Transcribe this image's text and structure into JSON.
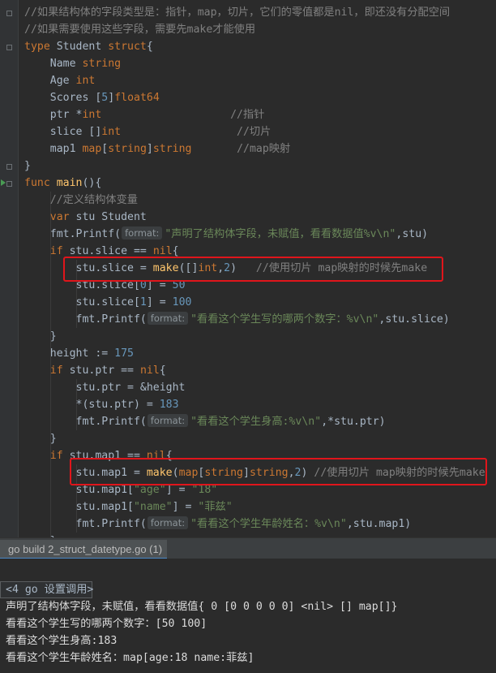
{
  "editor": {
    "lines": [
      [
        {
          "c": "c",
          "t": "//如果结构体的字段类型是：指针，map，切片，它们的零值都是nil，即还没有分配空间"
        }
      ],
      [
        {
          "c": "c",
          "t": "//如果需要使用这些字段，需要先make才能使用"
        }
      ],
      [
        {
          "c": "k",
          "t": "type "
        },
        {
          "c": "pl",
          "t": "Student "
        },
        {
          "c": "k",
          "t": "struct"
        },
        {
          "c": "pl",
          "t": "{"
        }
      ],
      [
        {
          "c": "pl",
          "t": "    Name "
        },
        {
          "c": "k",
          "t": "string"
        }
      ],
      [
        {
          "c": "pl",
          "t": "    Age "
        },
        {
          "c": "k",
          "t": "int"
        }
      ],
      [
        {
          "c": "pl",
          "t": "    Scores ["
        },
        {
          "c": "n",
          "t": "5"
        },
        {
          "c": "pl",
          "t": "]"
        },
        {
          "c": "k",
          "t": "float64"
        }
      ],
      [
        {
          "c": "pl",
          "t": "    ptr *"
        },
        {
          "c": "k",
          "t": "int"
        },
        {
          "c": "pl",
          "t": "                    "
        },
        {
          "c": "c",
          "t": "//指针"
        }
      ],
      [
        {
          "c": "pl",
          "t": "    slice []"
        },
        {
          "c": "k",
          "t": "int"
        },
        {
          "c": "pl",
          "t": "                  "
        },
        {
          "c": "c",
          "t": "//切片"
        }
      ],
      [
        {
          "c": "pl",
          "t": "    map1 "
        },
        {
          "c": "k",
          "t": "map"
        },
        {
          "c": "pl",
          "t": "["
        },
        {
          "c": "k",
          "t": "string"
        },
        {
          "c": "pl",
          "t": "]"
        },
        {
          "c": "k",
          "t": "string"
        },
        {
          "c": "pl",
          "t": "       "
        },
        {
          "c": "c",
          "t": "//map映射"
        }
      ],
      [
        {
          "c": "pl",
          "t": "}"
        }
      ],
      [
        {
          "c": "k",
          "t": "func "
        },
        {
          "c": "f",
          "t": "main"
        },
        {
          "c": "pl",
          "t": "(){"
        }
      ],
      [
        {
          "c": "pl",
          "t": "    "
        },
        {
          "c": "c",
          "t": "//定义结构体变量"
        }
      ],
      [
        {
          "c": "pl",
          "t": "    "
        },
        {
          "c": "k",
          "t": "var "
        },
        {
          "c": "pl",
          "t": "stu Student"
        }
      ],
      [
        {
          "c": "pl",
          "t": "    fmt."
        },
        {
          "c": "pl",
          "t": "Printf("
        },
        {
          "c": "hint",
          "t": "format:"
        },
        {
          "c": "s",
          "t": "\"声明了结构体字段，未赋值，看看数据值%v\\n\""
        },
        {
          "c": "pl",
          "t": ",stu)"
        }
      ],
      [
        {
          "c": "pl",
          "t": "    "
        },
        {
          "c": "k",
          "t": "if "
        },
        {
          "c": "pl",
          "t": "stu.slice == "
        },
        {
          "c": "k",
          "t": "nil"
        },
        {
          "c": "pl",
          "t": "{"
        }
      ],
      [
        {
          "c": "pl",
          "t": "        stu.slice = "
        },
        {
          "c": "f",
          "t": "make"
        },
        {
          "c": "pl",
          "t": "([]"
        },
        {
          "c": "k",
          "t": "int"
        },
        {
          "c": "pl",
          "t": ","
        },
        {
          "c": "n",
          "t": "2"
        },
        {
          "c": "pl",
          "t": ")   "
        },
        {
          "c": "c",
          "t": "//使用切片 map映射的时候先make"
        }
      ],
      [
        {
          "c": "pl",
          "t": "        stu.slice["
        },
        {
          "c": "n",
          "t": "0"
        },
        {
          "c": "pl",
          "t": "] = "
        },
        {
          "c": "n",
          "t": "50"
        }
      ],
      [
        {
          "c": "pl",
          "t": "        stu.slice["
        },
        {
          "c": "n",
          "t": "1"
        },
        {
          "c": "pl",
          "t": "] = "
        },
        {
          "c": "n",
          "t": "100"
        }
      ],
      [
        {
          "c": "pl",
          "t": "        fmt.Printf("
        },
        {
          "c": "hint",
          "t": "format:"
        },
        {
          "c": "s",
          "t": "\"看看这个学生写的哪两个数字：%v\\n\""
        },
        {
          "c": "pl",
          "t": ",stu.slice)"
        }
      ],
      [
        {
          "c": "pl",
          "t": "    }"
        }
      ],
      [
        {
          "c": "pl",
          "t": "    height := "
        },
        {
          "c": "n",
          "t": "175"
        }
      ],
      [
        {
          "c": "pl",
          "t": "    "
        },
        {
          "c": "k",
          "t": "if "
        },
        {
          "c": "pl",
          "t": "stu.ptr == "
        },
        {
          "c": "k",
          "t": "nil"
        },
        {
          "c": "pl",
          "t": "{"
        }
      ],
      [
        {
          "c": "pl",
          "t": "        stu.ptr = &height"
        }
      ],
      [
        {
          "c": "pl",
          "t": "        *(stu.ptr) = "
        },
        {
          "c": "n",
          "t": "183"
        }
      ],
      [
        {
          "c": "pl",
          "t": "        fmt.Printf("
        },
        {
          "c": "hint",
          "t": "format:"
        },
        {
          "c": "s",
          "t": "\"看看这个学生身高:%v\\n\""
        },
        {
          "c": "pl",
          "t": ",*stu.ptr)"
        }
      ],
      [
        {
          "c": "pl",
          "t": "    }"
        }
      ],
      [
        {
          "c": "pl",
          "t": "    "
        },
        {
          "c": "k",
          "t": "if "
        },
        {
          "c": "pl",
          "t": "stu.map1 == "
        },
        {
          "c": "k",
          "t": "nil"
        },
        {
          "c": "pl",
          "t": "{"
        }
      ],
      [
        {
          "c": "pl",
          "t": "        stu.map1 = "
        },
        {
          "c": "f",
          "t": "make"
        },
        {
          "c": "pl",
          "t": "("
        },
        {
          "c": "k",
          "t": "map"
        },
        {
          "c": "pl",
          "t": "["
        },
        {
          "c": "k",
          "t": "string"
        },
        {
          "c": "pl",
          "t": "]"
        },
        {
          "c": "k",
          "t": "string"
        },
        {
          "c": "pl",
          "t": ","
        },
        {
          "c": "n",
          "t": "2"
        },
        {
          "c": "pl",
          "t": ") "
        },
        {
          "c": "c",
          "t": "//使用切片 map映射的时候先make"
        }
      ],
      [
        {
          "c": "pl",
          "t": "        stu.map1["
        },
        {
          "c": "s",
          "t": "\"age\""
        },
        {
          "c": "pl",
          "t": "] = "
        },
        {
          "c": "s",
          "t": "\"18\""
        }
      ],
      [
        {
          "c": "pl",
          "t": "        stu.map1["
        },
        {
          "c": "s",
          "t": "\"name\""
        },
        {
          "c": "pl",
          "t": "] = "
        },
        {
          "c": "s",
          "t": "\"菲兹\""
        }
      ],
      [
        {
          "c": "pl",
          "t": "        fmt.Printf("
        },
        {
          "c": "hint",
          "t": "format:"
        },
        {
          "c": "s",
          "t": "\"看看这个学生年龄姓名：%v\\n\""
        },
        {
          "c": "pl",
          "t": ",stu.map1)"
        }
      ],
      [
        {
          "c": "pl",
          "t": "    }"
        }
      ]
    ]
  },
  "run_panel": {
    "tab_label": "go build 2_struct_datetype.go (1)",
    "output": [
      "<4 go 设置调用>",
      "声明了结构体字段，未赋值，看看数据值{ 0 [0 0 0 0 0] <nil> [] map[]}",
      "看看这个学生写的哪两个数字：[50 100]",
      "看看这个学生身高:183",
      "看看这个学生年龄姓名：map[age:18 name:菲兹]"
    ]
  },
  "colors": {
    "highlight_box": "#e0151b",
    "keyword": "#cc7832",
    "string": "#6a8759",
    "comment": "#808080"
  }
}
